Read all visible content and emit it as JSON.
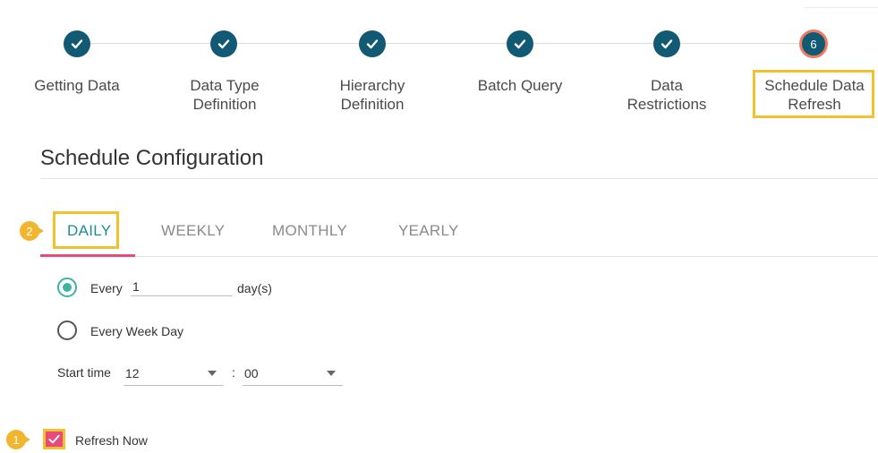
{
  "stepper": {
    "steps": [
      {
        "label": "Getting Data",
        "status": "complete"
      },
      {
        "label": "Data Type\nDefinition",
        "status": "complete"
      },
      {
        "label": "Hierarchy\nDefinition",
        "status": "complete"
      },
      {
        "label": "Batch Query",
        "status": "complete"
      },
      {
        "label": "Data\nRestrictions",
        "status": "complete"
      },
      {
        "label": "Schedule Data\nRefresh",
        "status": "current",
        "number": "6"
      }
    ]
  },
  "section": {
    "title": "Schedule Configuration"
  },
  "tabs": [
    {
      "label": "DAILY",
      "active": true
    },
    {
      "label": "WEEKLY",
      "active": false
    },
    {
      "label": "MONTHLY",
      "active": false
    },
    {
      "label": "YEARLY",
      "active": false
    }
  ],
  "daily": {
    "every_label": "Every",
    "every_value": "1",
    "every_unit": "day(s)",
    "every_selected": true,
    "weekday_label": "Every Week Day",
    "weekday_selected": false,
    "start_time_label": "Start time",
    "hour": "12",
    "time_separator": ":",
    "minute": "00"
  },
  "refresh": {
    "label": "Refresh Now",
    "checked": true
  },
  "callouts": {
    "one": "1",
    "two": "2"
  },
  "colors": {
    "step_complete": "#125974",
    "current_ring": "#ef7a5f",
    "highlight": "#f2c12e",
    "active_tab": "#1f8b9a",
    "tab_underline": "#e84b7a",
    "radio": "#3fb2a5",
    "checkbox": "#e84b7a"
  }
}
